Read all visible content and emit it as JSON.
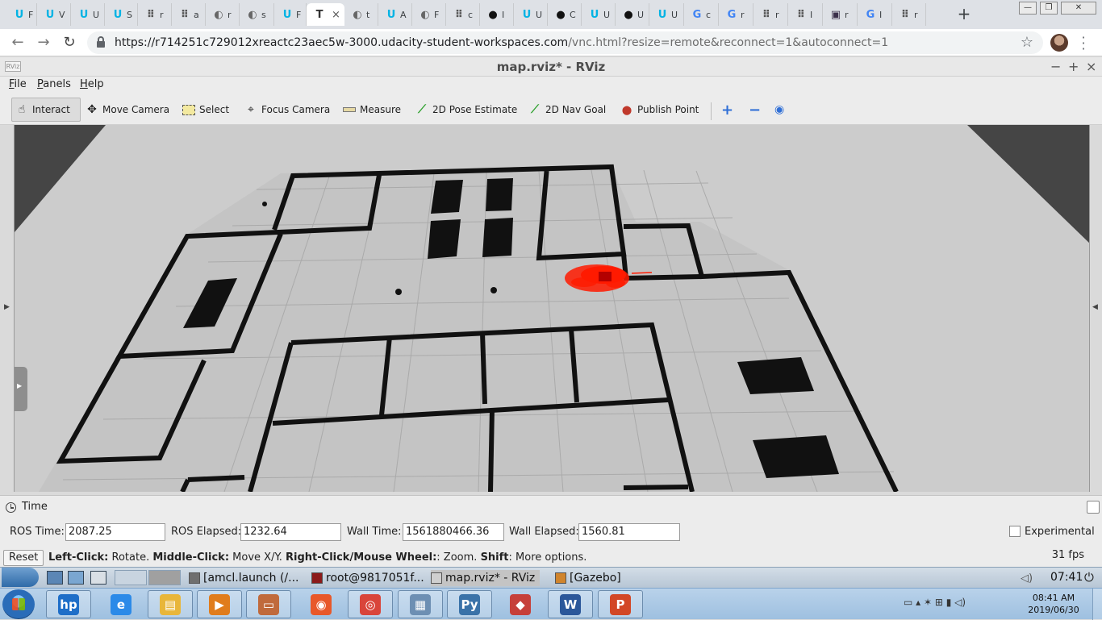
{
  "browser": {
    "tabs": [
      {
        "letter": "U",
        "title": "F",
        "color": "#02b3e4",
        "fav": "udacity-icon"
      },
      {
        "letter": "U",
        "title": "V",
        "color": "#02b3e4",
        "fav": "udacity-icon"
      },
      {
        "letter": "U",
        "title": "U",
        "color": "#02b3e4",
        "fav": "udacity-icon"
      },
      {
        "letter": "U",
        "title": "S",
        "color": "#02b3e4",
        "fav": "udacity-icon"
      },
      {
        "letter": "⠿",
        "title": "r",
        "color": "#555555",
        "fav": "grid-icon"
      },
      {
        "letter": "⠿",
        "title": "a",
        "color": "#555555",
        "fav": "grid-icon"
      },
      {
        "letter": "◐",
        "title": "r",
        "color": "#666666",
        "fav": "globe-icon"
      },
      {
        "letter": "◐",
        "title": "s",
        "color": "#666666",
        "fav": "globe-icon"
      },
      {
        "letter": "U",
        "title": "F",
        "color": "#02b3e4",
        "fav": "udacity-icon"
      },
      {
        "letter": "T",
        "title": "",
        "color": "#333333",
        "fav": "text-icon"
      },
      {
        "letter": "◐",
        "title": "t",
        "color": "#666666",
        "fav": "globe-icon"
      },
      {
        "letter": "U",
        "title": "A",
        "color": "#02b3e4",
        "fav": "udacity-icon"
      },
      {
        "letter": "◐",
        "title": "F",
        "color": "#666666",
        "fav": "globe-icon"
      },
      {
        "letter": "⠿",
        "title": "c",
        "color": "#555555",
        "fav": "grid-icon"
      },
      {
        "letter": "●",
        "title": "I",
        "color": "#111111",
        "fav": "github-icon"
      },
      {
        "letter": "U",
        "title": "U",
        "color": "#02b3e4",
        "fav": "udacity-icon"
      },
      {
        "letter": "●",
        "title": "C",
        "color": "#111111",
        "fav": "github-icon"
      },
      {
        "letter": "U",
        "title": "U",
        "color": "#02b3e4",
        "fav": "udacity-icon"
      },
      {
        "letter": "●",
        "title": "U",
        "color": "#111111",
        "fav": "github-icon"
      },
      {
        "letter": "U",
        "title": "U",
        "color": "#02b3e4",
        "fav": "udacity-icon"
      },
      {
        "letter": "G",
        "title": "c",
        "color": "#4285f4",
        "fav": "google-icon"
      },
      {
        "letter": "G",
        "title": "r",
        "color": "#4285f4",
        "fav": "google-icon"
      },
      {
        "letter": "⠿",
        "title": "r",
        "color": "#555555",
        "fav": "grid-icon"
      },
      {
        "letter": "⠿",
        "title": "I",
        "color": "#555555",
        "fav": "grid-icon"
      },
      {
        "letter": "▣",
        "title": "r",
        "color": "#3b2f4a",
        "fav": "photo-icon"
      },
      {
        "letter": "G",
        "title": "I",
        "color": "#4285f4",
        "fav": "google-icon"
      },
      {
        "letter": "⠿",
        "title": "r",
        "color": "#555555",
        "fav": "grid-icon"
      }
    ],
    "active_tab_close": "×",
    "new_tab": "+",
    "url_host": "https://r714251c729012xreactc23aec5w-3000.udacity-student-workspaces.com",
    "url_rest": "/vnc.html?resize=remote&reconnect=1&autoconnect=1",
    "back": "←",
    "forward": "→",
    "reload": "↻",
    "star": "☆",
    "menu": "⋮"
  },
  "rviz": {
    "title": "map.rviz* - RViz",
    "logo": "RViz",
    "window_controls": [
      "−",
      "+",
      "×"
    ],
    "menus": [
      {
        "key": "F",
        "rest": "ile"
      },
      {
        "key": "P",
        "rest": "anels"
      },
      {
        "key": "H",
        "rest": "elp"
      }
    ],
    "tools": [
      {
        "label": "Interact",
        "icon": "hand-icon",
        "glyph": "☝",
        "active": true
      },
      {
        "label": "Move Camera",
        "icon": "move-camera-icon",
        "glyph": "✥"
      },
      {
        "label": "Select",
        "icon": "select-icon",
        "glyph": "▭"
      },
      {
        "label": "Focus Camera",
        "icon": "focus-camera-icon",
        "glyph": "⌖"
      },
      {
        "label": "Measure",
        "icon": "measure-icon",
        "glyph": "▬"
      },
      {
        "label": "2D Pose Estimate",
        "icon": "pose-estimate-icon",
        "glyph": "⟋"
      },
      {
        "label": "2D Nav Goal",
        "icon": "nav-goal-icon",
        "glyph": "⟋"
      },
      {
        "label": "Publish Point",
        "icon": "publish-point-icon",
        "glyph": "⬤"
      }
    ],
    "tool_extras": [
      {
        "name": "add-tool-icon",
        "glyph": "+",
        "color": "#2f6fd6"
      },
      {
        "name": "remove-tool-icon",
        "glyph": "−",
        "color": "#2f6fd6"
      },
      {
        "name": "view-options-icon",
        "glyph": "◉",
        "color": "#2f6fd6"
      }
    ]
  },
  "time_panel": {
    "title": "Time",
    "ros_time_label": "ROS Time:",
    "ros_time": "2087.25",
    "ros_elapsed_label": "ROS Elapsed:",
    "ros_elapsed": "1232.64",
    "wall_time_label": "Wall Time:",
    "wall_time": "1561880466.36",
    "wall_elapsed_label": "Wall Elapsed:",
    "wall_elapsed": "1560.81",
    "experimental_label": "Experimental"
  },
  "status": {
    "reset": "Reset",
    "hint_left_key": "Left-Click:",
    "hint_left": " Rotate. ",
    "hint_middle_key": "Middle-Click:",
    "hint_middle": " Move X/Y. ",
    "hint_right_key": "Right-Click/Mouse Wheel:",
    "hint_right": ": Zoom. ",
    "hint_shift_key": "Shift",
    "hint_shift": ": More options.",
    "fps": "31 fps"
  },
  "vnc_taskbar": {
    "items": [
      {
        "label": "[amcl.launch (/...",
        "color": "#6f6f6f"
      },
      {
        "label": "root@9817051f...",
        "color": "#8b1a1a"
      },
      {
        "label": "map.rviz* - RViz",
        "color": "#cfcfcf"
      },
      {
        "label": "[Gazebo]",
        "color": "#d0842c"
      }
    ],
    "time": "07:41"
  },
  "windows_taskbar": {
    "pinned": [
      {
        "name": "hp-icon",
        "glyph": "hp",
        "color": "#1e6ec8"
      },
      {
        "name": "internet-explorer-icon",
        "glyph": "e",
        "color": "#2b8ae8"
      },
      {
        "name": "file-explorer-icon",
        "glyph": "▤",
        "color": "#e8b63a"
      },
      {
        "name": "media-player-icon",
        "glyph": "▶",
        "color": "#e07c1c"
      },
      {
        "name": "remote-desktop-icon",
        "glyph": "▭",
        "color": "#c06a3c"
      },
      {
        "name": "firefox-icon",
        "glyph": "◉",
        "color": "#e8582a"
      },
      {
        "name": "chrome-icon",
        "glyph": "◎",
        "color": "#d9453a"
      },
      {
        "name": "calculator-icon",
        "glyph": "▦",
        "color": "#6d8fb3"
      },
      {
        "name": "python-icon",
        "glyph": "Py",
        "color": "#3a72a8"
      },
      {
        "name": "snip-icon",
        "glyph": "◆",
        "color": "#c6403a"
      },
      {
        "name": "word-icon",
        "glyph": "W",
        "color": "#2b579a"
      },
      {
        "name": "powerpoint-icon",
        "glyph": "P",
        "color": "#d24726"
      }
    ],
    "tray": "▭  ▴ ✶ ⊞ ▮ ◁)",
    "clock_time": "08:41 AM",
    "clock_date": "2019/06/30"
  }
}
